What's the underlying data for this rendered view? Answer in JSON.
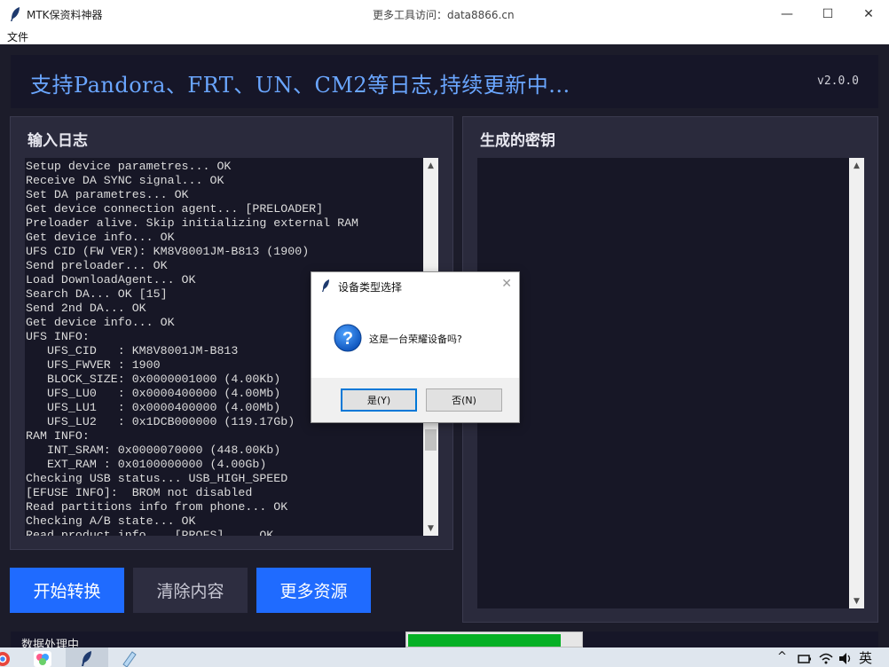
{
  "window": {
    "app_title": "MTK保资料神器",
    "center_title": "更多工具访问：data8866.cn",
    "min_glyph": "—",
    "max_glyph": "☐",
    "close_glyph": "✕"
  },
  "menu": {
    "file": "文件"
  },
  "banner": {
    "text": "支持Pandora、FRT、UN、CM2等日志,持续更新中...",
    "version": "v2.0.0"
  },
  "input_panel": {
    "title": "输入日志",
    "lines": [
      "Setup device parametres... OK",
      "Receive DA SYNC signal... OK",
      "Set DA parametres... OK",
      "Get device connection agent... [PRELOADER]",
      "Preloader alive. Skip initializing external RAM",
      "Get device info... OK",
      "UFS CID (FW VER): KM8V8001JM-B813 (1900)",
      "Send preloader... OK",
      "Load DownloadAgent... OK",
      "Search DA... OK [15]",
      "Send 2nd DA... OK",
      "Get device info... OK",
      "UFS INFO:",
      "   UFS_CID   : KM8V8001JM-B813",
      "   UFS_FWVER : 1900",
      "   BLOCK_SIZE: 0x0000001000 (4.00Kb)",
      "   UFS_LU0   : 0x0000400000 (4.00Mb)",
      "   UFS_LU1   : 0x0000400000 (4.00Mb)",
      "   UFS_LU2   : 0x1DCB000000 (119.17Gb)",
      "RAM INFO:",
      "   INT_SRAM: 0x0000070000 (448.00Kb)",
      "   EXT_RAM : 0x0100000000 (4.00Gb)",
      "Checking USB status... USB_HIGH_SPEED",
      "[EFUSE INFO]:  BROM not disabled",
      "Read partitions info from phone... OK",
      "Checking A/B state... OK",
      "Read product info... [PROFS]     OK"
    ]
  },
  "output_panel": {
    "title": "生成的密钥"
  },
  "buttons": {
    "start": "开始转换",
    "clear": "清除内容",
    "more": "更多资源"
  },
  "status": {
    "text": "数据处理中",
    "progress": 0.88
  },
  "dialog": {
    "title": "设备类型选择",
    "message": "这是一台荣耀设备吗?",
    "yes": "是(Y)",
    "no": "否(N)",
    "close_glyph": "✕",
    "question_glyph": "?"
  },
  "taskbar": {
    "tray_lang": "英",
    "tray_chevron": "^"
  },
  "colors": {
    "accent_blue": "#1f6bff",
    "banner_text": "#6aa6ff",
    "progress_green": "#06b025"
  }
}
